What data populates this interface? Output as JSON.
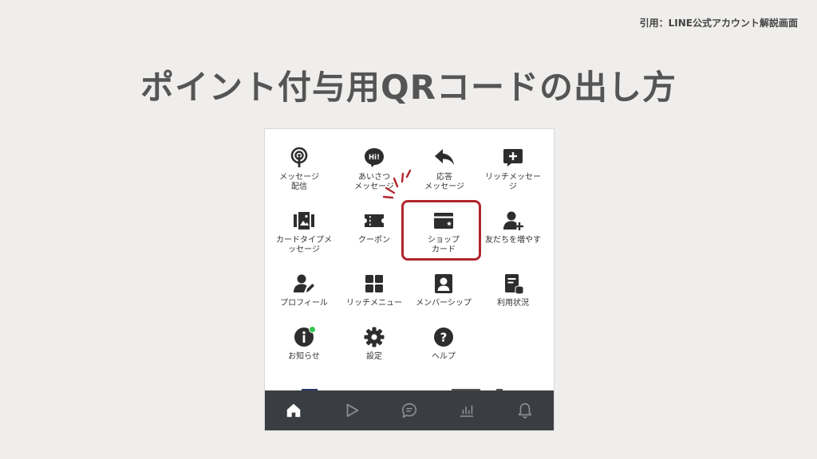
{
  "citation": "引用：LINE公式アカウント解説画面",
  "title": "ポイント付与用QRコードの出し方",
  "menu": [
    {
      "label": "メッセージ\n配信",
      "icon": "broadcast-icon"
    },
    {
      "label": "あいさつ\nメッセージ",
      "icon": "hi-bubble-icon"
    },
    {
      "label": "応答\nメッセージ",
      "icon": "reply-arrow-icon"
    },
    {
      "label": "リッチメッセー\nジ",
      "icon": "rich-message-icon"
    },
    {
      "label": "カードタイプメ\nッセージ",
      "icon": "card-type-icon"
    },
    {
      "label": "クーポン",
      "icon": "coupon-icon"
    },
    {
      "label": "ショップ\nカード",
      "icon": "shop-card-icon"
    },
    {
      "label": "友だちを増やす",
      "icon": "add-friend-icon"
    },
    {
      "label": "プロフィール",
      "icon": "profile-edit-icon"
    },
    {
      "label": "リッチメニュー",
      "icon": "rich-menu-icon"
    },
    {
      "label": "メンバーシップ",
      "icon": "membership-icon"
    },
    {
      "label": "利用状況",
      "icon": "usage-icon"
    },
    {
      "label": "お知らせ",
      "icon": "info-icon"
    },
    {
      "label": "設定",
      "icon": "gear-icon"
    },
    {
      "label": "ヘルプ",
      "icon": "help-icon"
    }
  ],
  "nav": [
    "home-icon",
    "play-icon",
    "chat-icon",
    "chart-icon",
    "bell-icon"
  ],
  "colors": {
    "accent": "#b0262d",
    "nav_bg": "#3a3d41",
    "notify_dot": "#2fc64a"
  }
}
